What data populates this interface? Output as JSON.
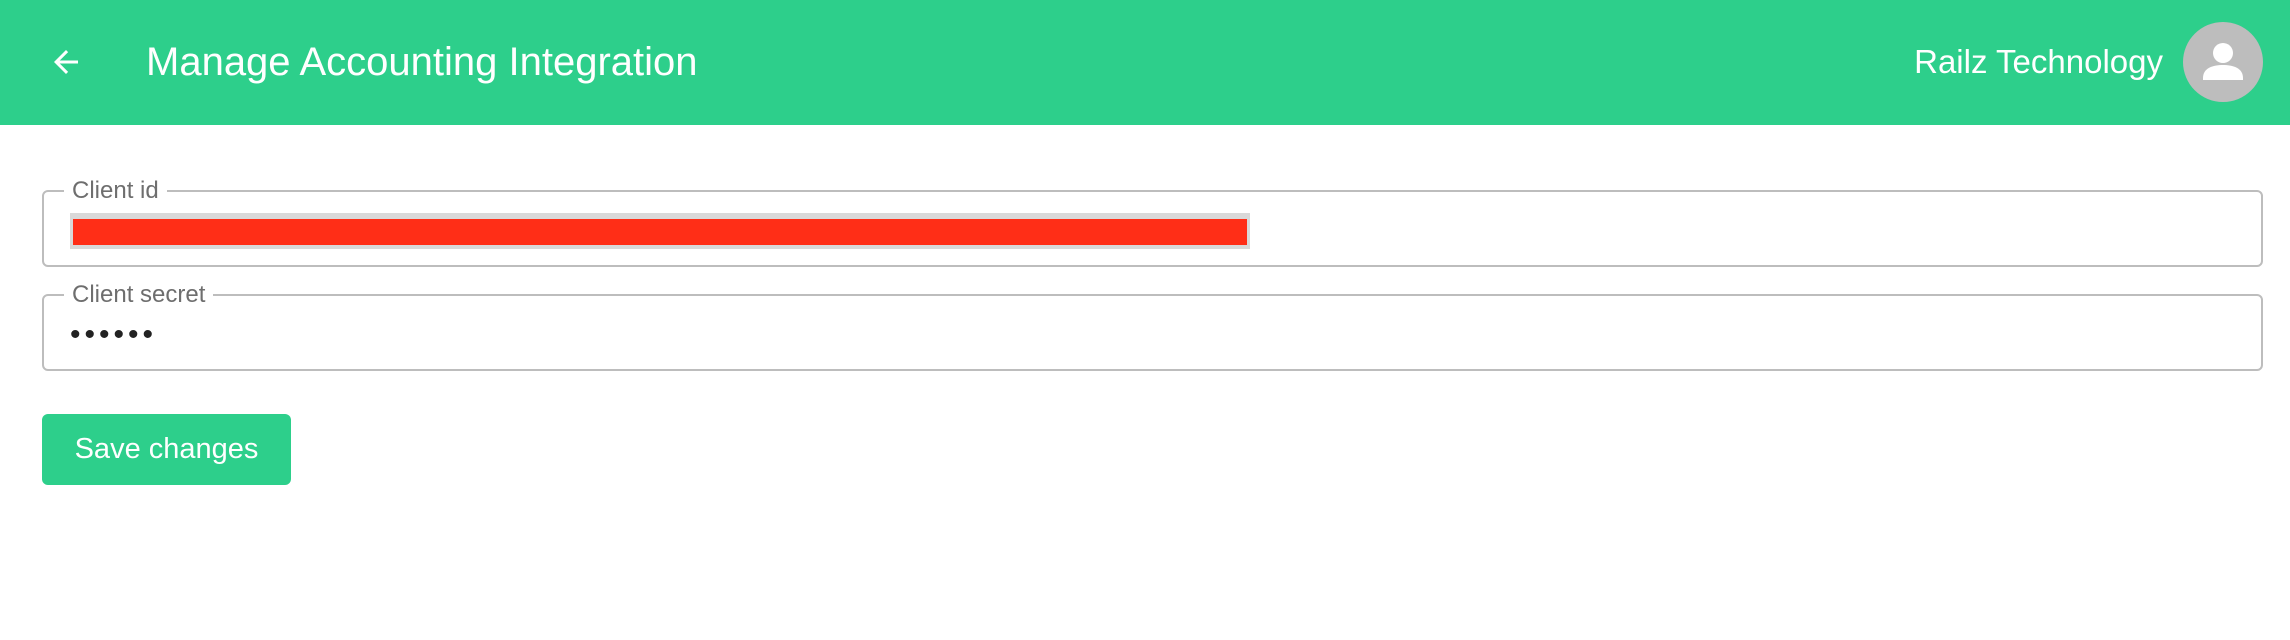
{
  "header": {
    "title": "Manage Accounting Integration",
    "company": "Railz Technology",
    "back_icon": "arrow-left-icon",
    "avatar_icon": "person-icon",
    "bg_color": "#2dcf8b"
  },
  "form": {
    "client_id": {
      "label": "Client id",
      "value": ""
    },
    "client_secret": {
      "label": "Client secret",
      "value": "••••••"
    },
    "save_label": "Save changes"
  }
}
